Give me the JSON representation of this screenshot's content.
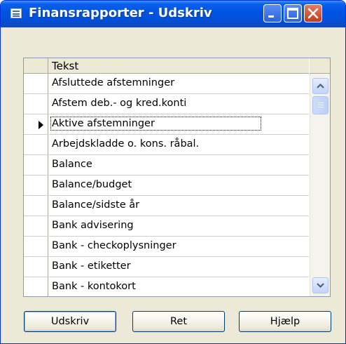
{
  "window": {
    "title": "Finansrapporter - Udskriv",
    "accent_color": "#0054e3",
    "icons": [
      "table-window-icon",
      "minimize-icon",
      "maximize-icon",
      "close-icon"
    ]
  },
  "list": {
    "column_header": "Tekst",
    "current_row_index": 2,
    "rows": [
      "Afsluttede afstemninger",
      "Afstem deb.- og kred.konti",
      "Aktive afstemninger",
      "Arbejdskladde o. kons. råbal.",
      "Balance",
      "Balance/budget",
      "Balance/sidste år",
      "Bank advisering",
      "Bank - checkoplysninger",
      "Bank - etiketter",
      "Bank - kontokort"
    ]
  },
  "buttons": {
    "print_label": "Udskriv",
    "edit_label": "Ret",
    "help_label": "Hjælp"
  }
}
